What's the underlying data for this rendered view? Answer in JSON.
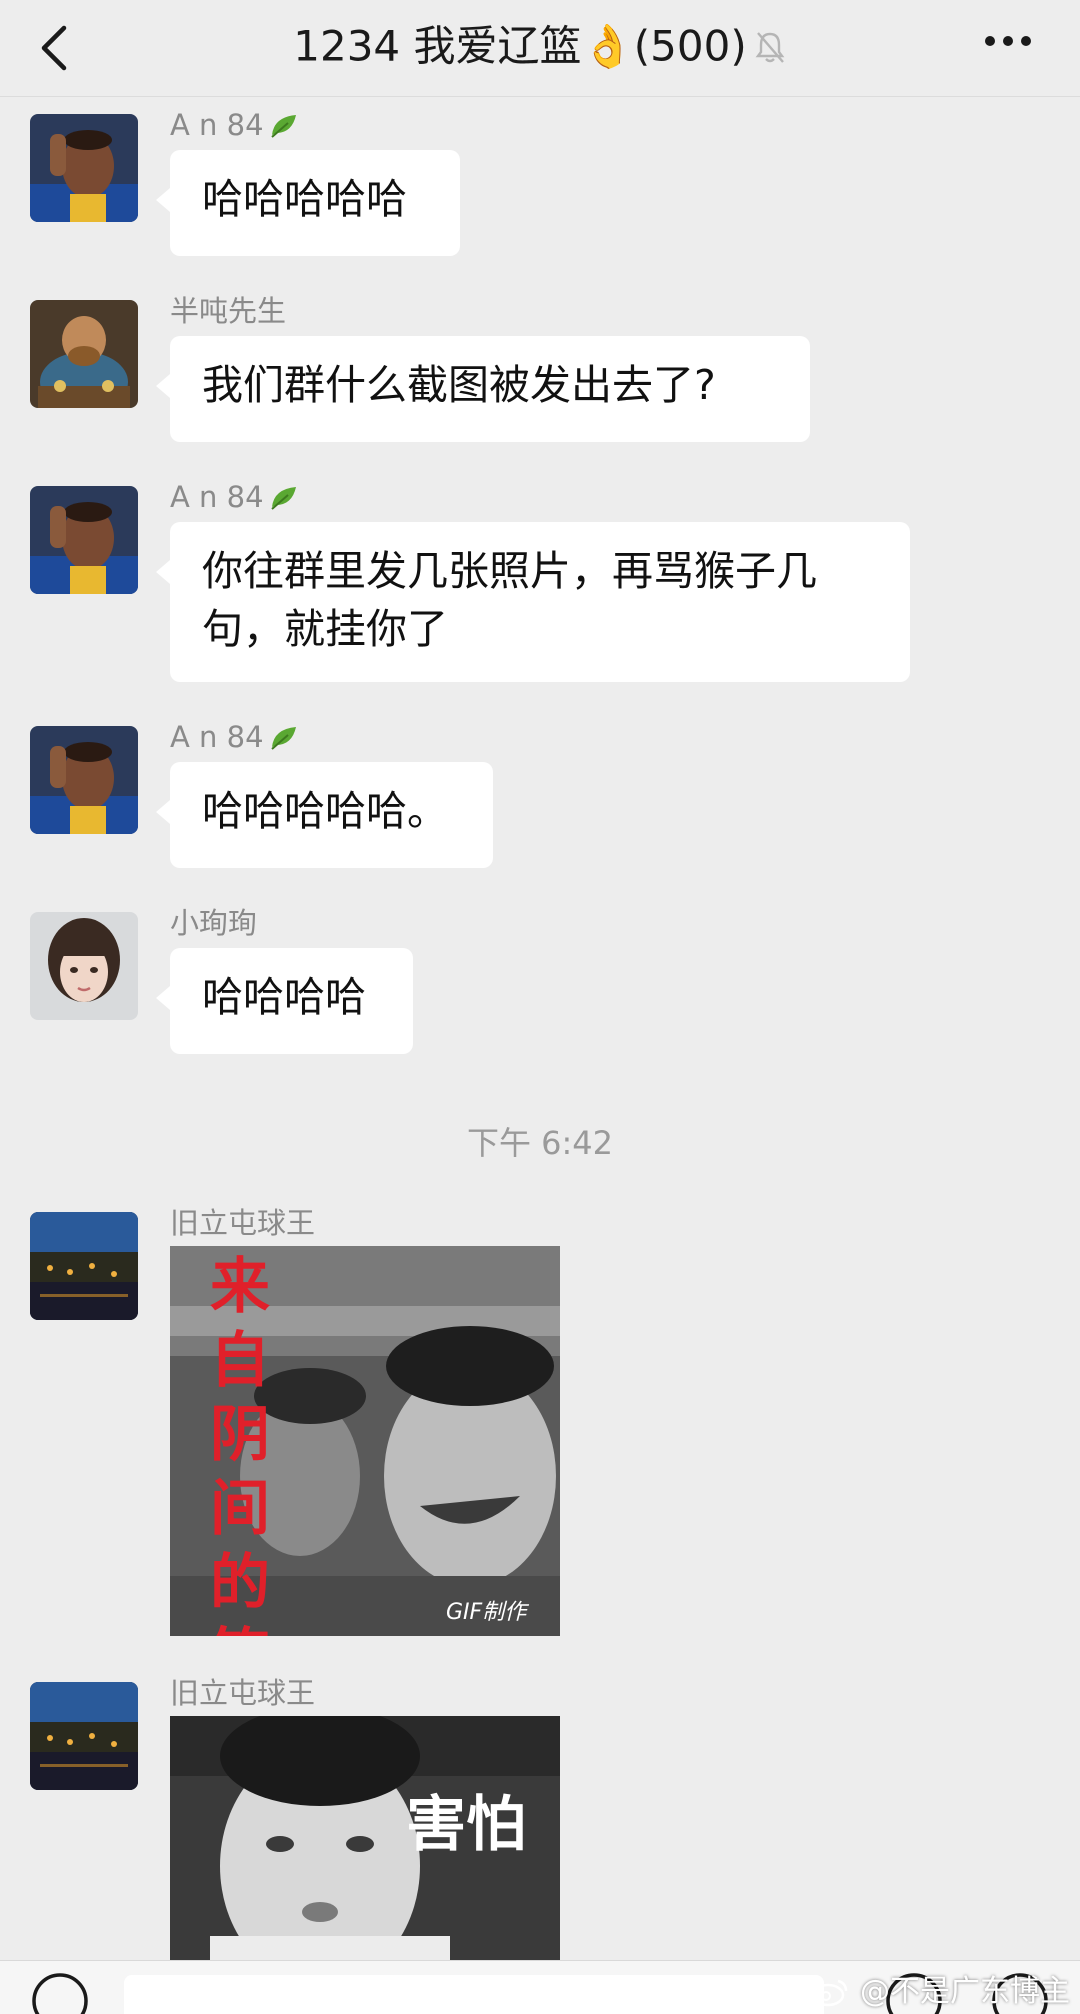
{
  "header": {
    "title": "1234 我爱辽篮",
    "emoji": "👌",
    "member_count": "(500)"
  },
  "messages": [
    {
      "sender": "A n   84",
      "text": "哈哈哈哈哈"
    },
    {
      "sender": "半吨先生",
      "text": "我们群什么截图被发出去了?"
    },
    {
      "sender": "A n   84",
      "text_line1": "你往群里发几张照片，再骂猴子几",
      "text_line2": "句，就挂你了"
    },
    {
      "sender": "A n   84",
      "text": "哈哈哈哈哈。"
    },
    {
      "sender": "小珣珣",
      "text": "哈哈哈哈"
    }
  ],
  "timestamp": "下午 6:42",
  "sticker_messages": [
    {
      "sender": "旧立屯球王",
      "caption": "来自阴间的笑",
      "badge": "GIF制作"
    },
    {
      "sender": "旧立屯球王",
      "caption": "害怕"
    }
  ],
  "watermark": "@不是广东博主",
  "colors": {
    "background": "#ededed",
    "bubble": "#ffffff",
    "meta_text": "#8a8a8a",
    "sticker_red": "#e0202a"
  }
}
